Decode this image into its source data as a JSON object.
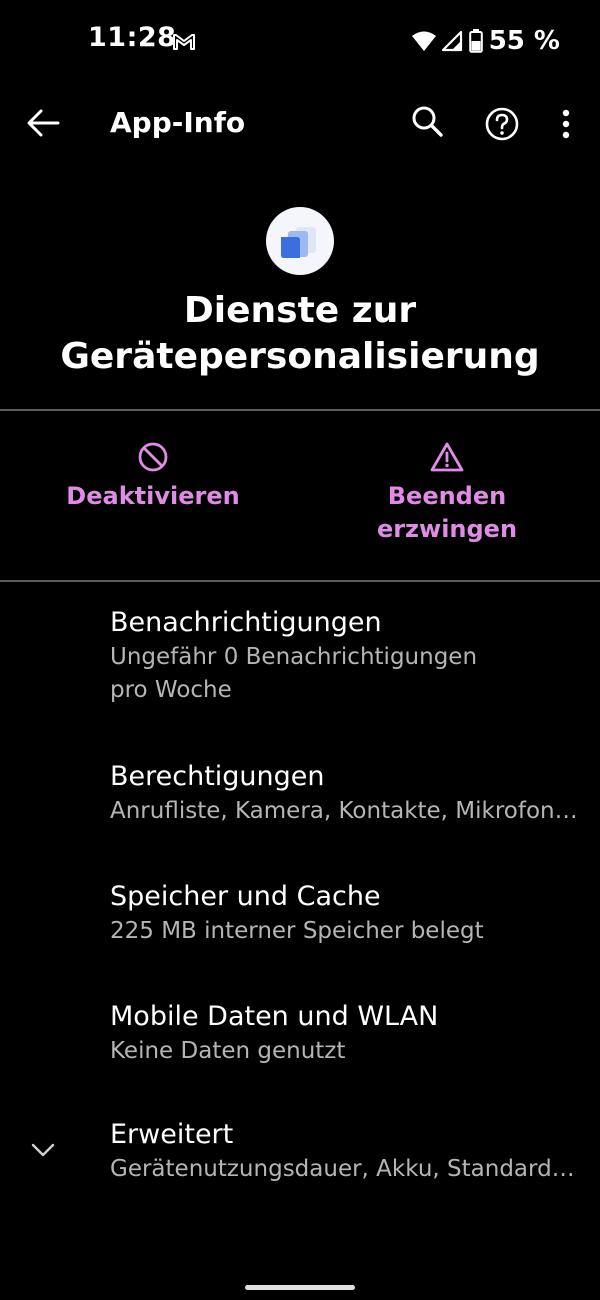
{
  "status_bar": {
    "time": "11:28",
    "notification_icons": [
      "gmail-icon"
    ],
    "system_icons": [
      "wifi-icon",
      "cell-signal-icon",
      "battery-icon"
    ],
    "battery": "55 %"
  },
  "app_bar": {
    "title": "App-Info",
    "actions": [
      "back-arrow-icon",
      "search-icon",
      "help-icon",
      "more-vert-icon"
    ]
  },
  "app": {
    "icon": "device-personalization-icon",
    "name_line1": "Dienste zur",
    "name_line2": "Gerätepersonalisierung"
  },
  "actions": {
    "disable": {
      "icon": "block-icon",
      "label": "Deaktivieren"
    },
    "force_stop": {
      "icon": "warning-icon",
      "label_line1": "Beenden",
      "label_line2": "erzwingen"
    }
  },
  "preferences": {
    "notifications": {
      "title": "Benachrichtigungen",
      "summary_line1": "Ungefähr 0 Benachrichtigungen",
      "summary_line2": "pro Woche"
    },
    "permissions": {
      "title": "Berechtigungen",
      "summary": "Anrufliste, Kamera, Kontakte, Mikrofon, Telefon"
    },
    "storage": {
      "title": "Speicher und Cache",
      "summary": "225 MB interner Speicher belegt"
    },
    "data": {
      "title": "Mobile Daten und WLAN",
      "summary": "Keine Daten genutzt"
    },
    "advanced": {
      "icon": "chevron-down-icon",
      "title": "Erweitert",
      "summary": "Gerätenutzungsdauer, Akku, Standardmäßig öffnen"
    }
  },
  "colors": {
    "background": "#000000",
    "accent": "#e08be6",
    "text_primary": "#ffffff",
    "text_secondary": "#b5b5b5",
    "divider": "#5c5c5c"
  }
}
